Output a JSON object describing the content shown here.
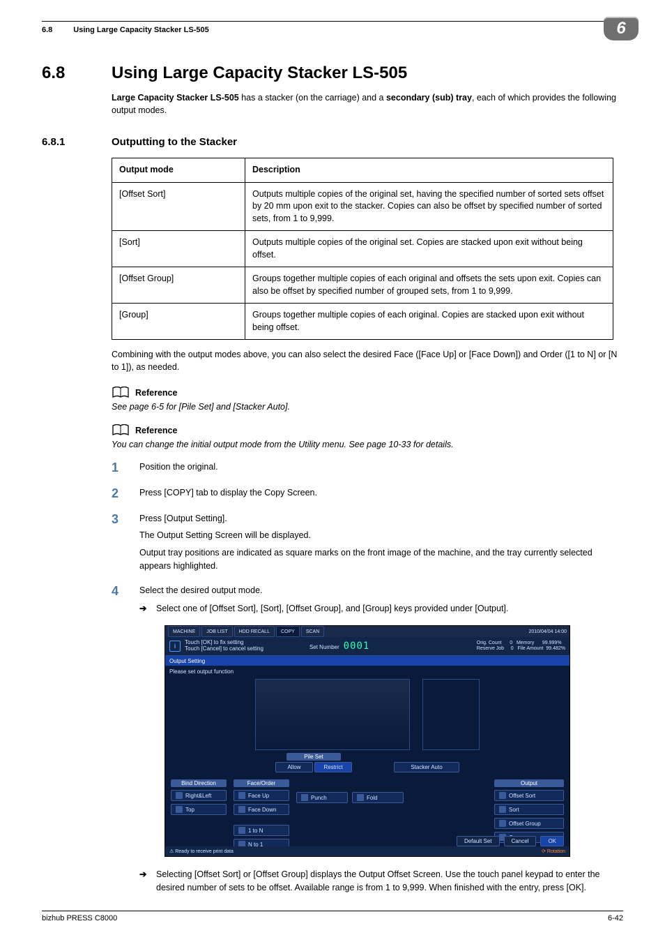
{
  "header": {
    "section_no": "6.8",
    "section_title_header": "Using Large Capacity Stacker LS-505",
    "chapter_badge": "6"
  },
  "section": {
    "number": "6.8",
    "title": "Using Large Capacity Stacker LS-505"
  },
  "intro": {
    "bold1": "Large Capacity Stacker LS-505",
    "mid": " has a stacker (on the carriage) and a ",
    "bold2": "secondary (sub) tray",
    "tail": ", each of which provides the following output modes."
  },
  "subsection": {
    "number": "6.8.1",
    "title": "Outputting to the Stacker"
  },
  "table": {
    "head_mode": "Output mode",
    "head_desc": "Description",
    "rows": [
      {
        "mode": "[Offset Sort]",
        "desc": "Outputs multiple copies of the original set, having the specified number of sorted sets offset by 20 mm upon exit to the stacker. Copies can also be offset by specified number of sorted sets, from 1 to 9,999."
      },
      {
        "mode": "[Sort]",
        "desc": "Outputs multiple copies of the original set. Copies are stacked upon exit without being offset."
      },
      {
        "mode": "[Offset Group]",
        "desc": "Groups together multiple copies of each original and offsets the sets upon exit. Copies can also be offset by specified number of grouped sets, from 1 to 9,999."
      },
      {
        "mode": "[Group]",
        "desc": "Groups together multiple copies of each original. Copies are stacked upon exit without being offset."
      }
    ]
  },
  "combine_note": "Combining with the output modes above, you can also select the desired Face ([Face Up] or [Face Down]) and Order ([1 to N] or [N to 1]), as needed.",
  "ref1": {
    "title": "Reference",
    "text": "See page 6-5 for [Pile Set] and [Stacker Auto]."
  },
  "ref2": {
    "title": "Reference",
    "text": "You can change the initial output mode from the Utility menu. See page 10-33 for details."
  },
  "steps": {
    "s1": {
      "n": "1",
      "t": "Position the original."
    },
    "s2": {
      "n": "2",
      "t": "Press [COPY] tab to display the Copy Screen."
    },
    "s3": {
      "n": "3",
      "t": "Press [Output Setting].",
      "sub1": "The Output Setting Screen will be displayed.",
      "sub2": "Output tray positions are indicated as square marks on the front image of the machine, and the tray currently selected appears highlighted."
    },
    "s4": {
      "n": "4",
      "t": "Select the desired output mode.",
      "arrow1": "Select one of [Offset Sort], [Sort], [Offset Group], and [Group] keys provided under [Output].",
      "arrow2": "Selecting [Offset Sort] or [Offset Group] displays the Output Offset Screen. Use the touch panel keypad to enter the desired number of sets to be offset. Available range is from 1 to 9,999. When finished with the entry, press [OK]."
    }
  },
  "screenshot": {
    "tabs": {
      "machine": "MACHINE",
      "joblist": "JOB LIST",
      "hold": "HDD RECALL",
      "copy": "COPY",
      "scan": "SCAN"
    },
    "datetime": "2010/04/04 14:00",
    "info_l1": "Touch [OK] to fix setting",
    "info_l2": "Touch [Cancel] to cancel setting",
    "set_number_label": "Set Number",
    "set_number_value": "0001",
    "stats": "Orig. Count      0   Memory      99.999%\nReserve Job     0   File Amount  99.482%",
    "strip": "Output Setting",
    "msg": "Please set output function",
    "pile_set": "Pile Set",
    "allow": "Allow",
    "restrict": "Restrict",
    "stacker_auto": "Stacker Auto",
    "group_bind": "Bind Direction",
    "group_face": "Face/Order",
    "group_output": "Output",
    "btn_rl": "Right&Left",
    "btn_top": "Top",
    "btn_fu": "Face Up",
    "btn_fd": "Face Down",
    "btn_1n": "1 to N",
    "btn_n1": "N to 1",
    "btn_punch": "Punch",
    "btn_fold": "Fold",
    "btn_osort": "Offset Sort",
    "btn_sort": "Sort",
    "btn_ogroup": "Offset Group",
    "btn_group": "Group",
    "btn_default": "Default Set",
    "btn_cancel": "Cancel",
    "btn_ok": "OK",
    "foot_left": "Ready to receive print data",
    "foot_right": "Rotation"
  },
  "footer": {
    "left": "bizhub PRESS C8000",
    "right": "6-42"
  }
}
